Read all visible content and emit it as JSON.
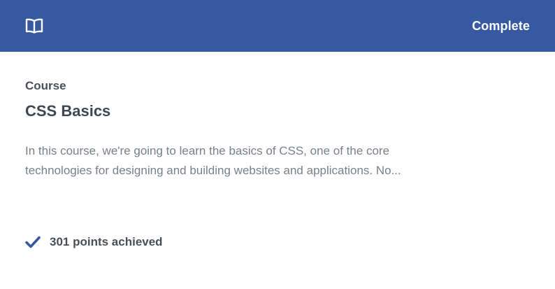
{
  "header": {
    "icon": "book-open-icon",
    "status_label": "Complete",
    "background": "#3659a2"
  },
  "course": {
    "kind_label": "Course",
    "title": "CSS Basics",
    "description_line_1": "In this course, we're going to learn the basics of CSS, one of the core",
    "description_line_2": "technologies for designing and building websites and applications. No..."
  },
  "achievement": {
    "icon": "checkmark-icon",
    "label": "301 points achieved",
    "accent": "#3659a2"
  }
}
